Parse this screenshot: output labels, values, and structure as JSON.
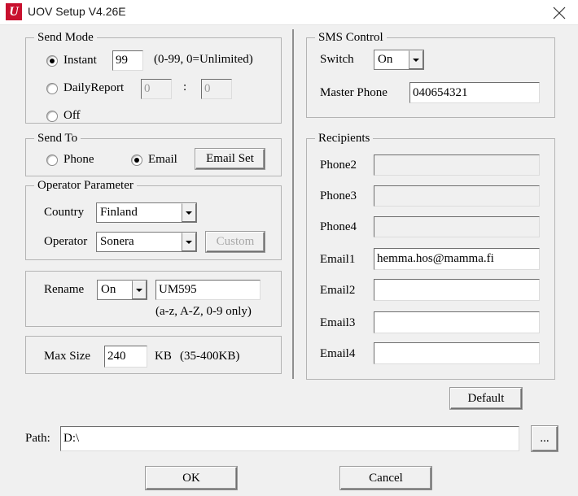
{
  "window": {
    "title": "UOV Setup V4.26E",
    "logo_letter": "U",
    "logo_color": "#c8102e",
    "close_icon": "close-icon"
  },
  "send_mode": {
    "group_title": "Send Mode",
    "options": [
      {
        "label": "Instant",
        "checked": true
      },
      {
        "label": "DailyReport",
        "checked": false
      },
      {
        "label": "Off",
        "checked": false
      }
    ],
    "instant_value": "99",
    "instant_hint": "(0-99, 0=Unlimited)",
    "daily_hour": "0",
    "daily_separator": ":",
    "daily_minute": "0"
  },
  "send_to": {
    "group_title": "Send To",
    "options": [
      {
        "label": "Phone",
        "checked": false
      },
      {
        "label": "Email",
        "checked": true
      }
    ],
    "email_set_label": "Email Set"
  },
  "operator_parameter": {
    "group_title": "Operator Parameter",
    "country_label": "Country",
    "country_value": "Finland",
    "operator_label": "Operator",
    "operator_value": "Sonera",
    "custom_label": "Custom"
  },
  "rename": {
    "label": "Rename",
    "switch_value": "On",
    "name_value": "UM595",
    "hint": "(a-z, A-Z, 0-9 only)"
  },
  "max_size": {
    "label": "Max Size",
    "value": "240",
    "unit": "KB",
    "hint": "(35-400KB)"
  },
  "sms_control": {
    "group_title": "SMS Control",
    "switch_label": "Switch",
    "switch_value": "On",
    "master_phone_label": "Master Phone",
    "master_phone_value": "040654321"
  },
  "recipients": {
    "group_title": "Recipients",
    "rows": [
      {
        "label": "Phone2",
        "value": "",
        "disabled": true
      },
      {
        "label": "Phone3",
        "value": "",
        "disabled": true
      },
      {
        "label": "Phone4",
        "value": "",
        "disabled": true
      },
      {
        "label": "Email1",
        "value": "hemma.hos@mamma.fi",
        "disabled": false
      },
      {
        "label": "Email2",
        "value": "",
        "disabled": false
      },
      {
        "label": "Email3",
        "value": "",
        "disabled": false
      },
      {
        "label": "Email4",
        "value": "",
        "disabled": false
      }
    ]
  },
  "default_button": {
    "label": "Default"
  },
  "path": {
    "label": "Path:",
    "value": "D:\\",
    "browse_label": "..."
  },
  "footer": {
    "ok_label": "OK",
    "cancel_label": "Cancel"
  }
}
